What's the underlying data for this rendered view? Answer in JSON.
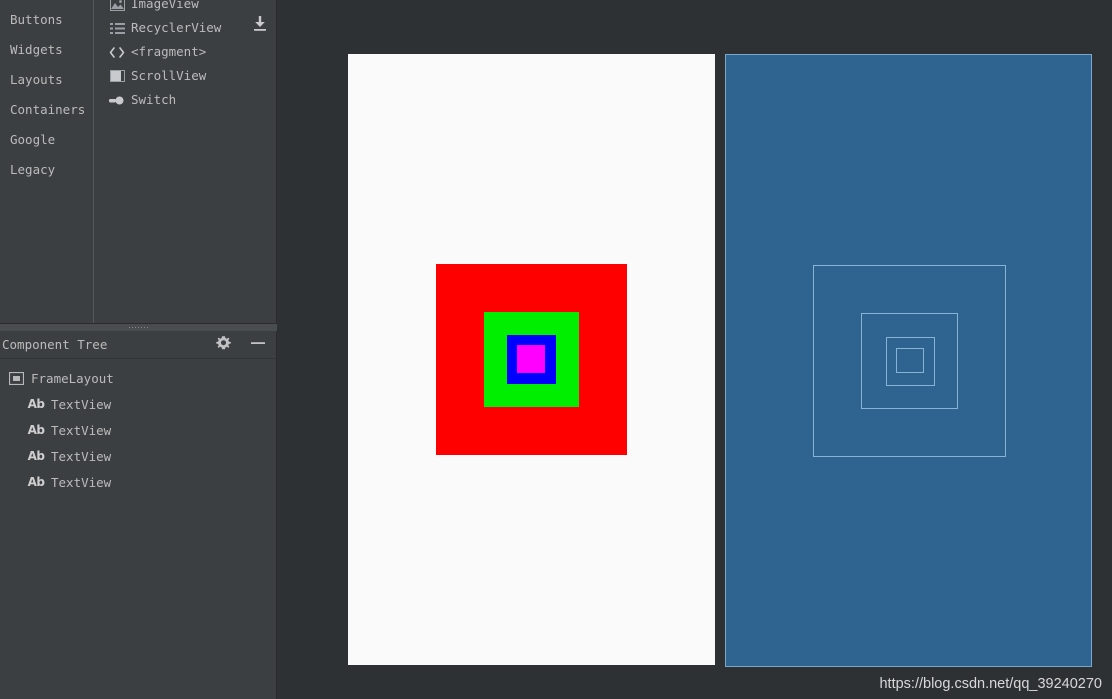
{
  "palette": {
    "categories": [
      {
        "label": "Buttons"
      },
      {
        "label": "Widgets"
      },
      {
        "label": "Layouts"
      },
      {
        "label": "Containers"
      },
      {
        "label": "Google"
      },
      {
        "label": "Legacy"
      }
    ],
    "items": [
      {
        "label": "ImageView",
        "icon": "image-icon"
      },
      {
        "label": "RecyclerView",
        "icon": "list-icon"
      },
      {
        "label": "<fragment>",
        "icon": "code-brackets-icon"
      },
      {
        "label": "ScrollView",
        "icon": "scrollview-icon"
      },
      {
        "label": "Switch",
        "icon": "switch-icon"
      }
    ],
    "download_icon": "download-icon"
  },
  "component_tree": {
    "title": "Component Tree",
    "settings_icon": "gear-icon",
    "minimize_icon": "minimize-icon",
    "nodes": [
      {
        "label": "FrameLayout",
        "icon": "framelayout-icon",
        "depth": 0
      },
      {
        "label": "TextView",
        "icon": "ab-icon",
        "depth": 1
      },
      {
        "label": "TextView",
        "icon": "ab-icon",
        "depth": 1
      },
      {
        "label": "TextView",
        "icon": "ab-icon",
        "depth": 1
      },
      {
        "label": "TextView",
        "icon": "ab-icon",
        "depth": 1
      }
    ]
  },
  "editor": {
    "design_view": {
      "background": "#fafafa",
      "squares": [
        {
          "name": "red-square",
          "color": "#ff0000"
        },
        {
          "name": "green-square",
          "color": "#00ee00"
        },
        {
          "name": "blue-square",
          "color": "#0000ff"
        },
        {
          "name": "magenta-square",
          "color": "#ff00ff"
        }
      ]
    },
    "blueprint_view": {
      "background": "#2f6491",
      "outline_color": "#87b4d6",
      "outlines": [
        {
          "name": "blueprint-outline-1"
        },
        {
          "name": "blueprint-outline-2"
        },
        {
          "name": "blueprint-outline-3"
        },
        {
          "name": "blueprint-outline-4"
        }
      ]
    }
  },
  "watermark": {
    "text": "https://blog.csdn.net/qq_39240270"
  },
  "colors": {
    "panel_bg": "#3c3f41",
    "canvas_bg": "#2e3133",
    "text": "#bbbbbb",
    "blueprint_bg": "#2f6491",
    "blueprint_stroke": "#87b4d6"
  }
}
